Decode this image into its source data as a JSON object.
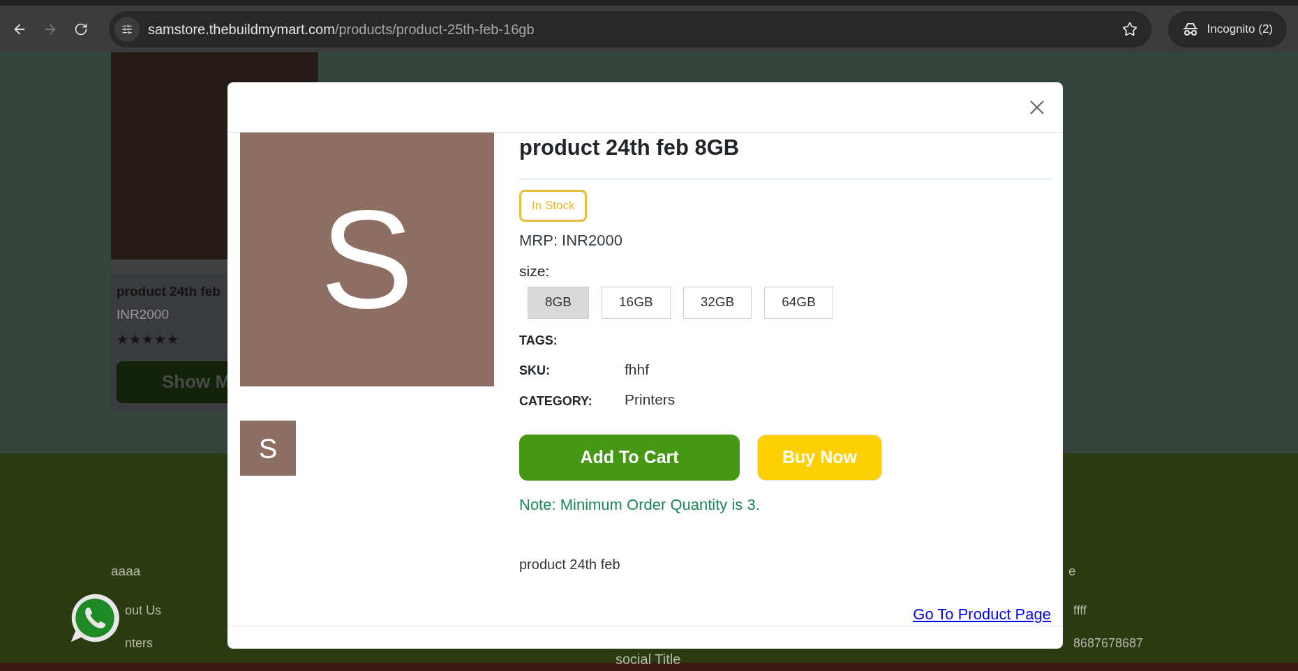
{
  "browser": {
    "url_host": "samstore.thebuildmymart.com",
    "url_path": "/products/product-25th-feb-16gb",
    "back_disabled": false,
    "forward_disabled": true,
    "profile_label": "Incognito (2)"
  },
  "page": {
    "product_card": {
      "title": "product 24th feb",
      "price": "INR2000",
      "stars": 5,
      "button": "Show M"
    },
    "footer": {
      "columns": [
        {
          "heading": "aaaa",
          "links": [
            "out Us",
            "nters"
          ]
        },
        {
          "heading": "e",
          "links": [
            "ffff",
            "8687678687"
          ]
        }
      ],
      "social_title": "social Title"
    }
  },
  "modal": {
    "image_letter": "S",
    "thumbnails": [
      {
        "letter": "S",
        "selected": true
      }
    ],
    "title": "product 24th feb 8GB",
    "stock_badge": "In Stock",
    "mrp": "MRP: INR2000",
    "size_label": "size:",
    "sizes": [
      {
        "label": "8GB",
        "selected": true
      },
      {
        "label": "16GB",
        "selected": false
      },
      {
        "label": "32GB",
        "selected": false
      },
      {
        "label": "64GB",
        "selected": false
      }
    ],
    "details": [
      {
        "label": "TAGS:"
      },
      {
        "label": "SKU:",
        "value": "fhhf"
      },
      {
        "label": "CATEGORY:",
        "value": "Printers"
      }
    ],
    "add_to_cart": "Add To Cart",
    "buy_now": "Buy Now",
    "note": "Note: Minimum Order Quantity is 3.",
    "description": "product 24th feb",
    "product_link": "Go To Product Page"
  }
}
